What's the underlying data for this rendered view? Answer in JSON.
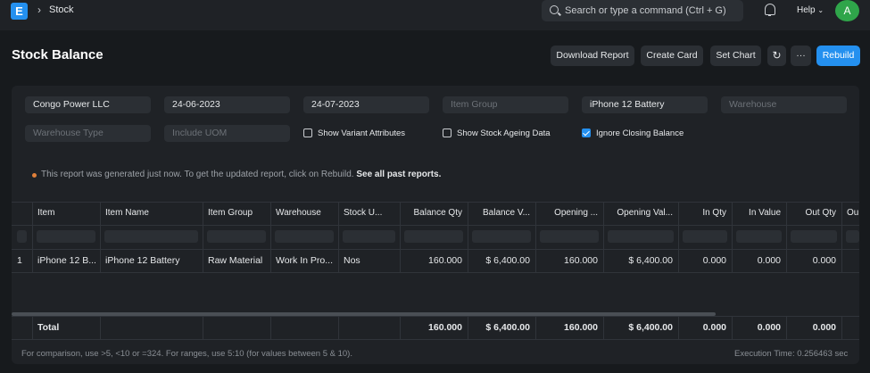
{
  "navbar": {
    "logo": "E",
    "breadcrumb": "Stock",
    "search_placeholder": "Search or type a command (Ctrl + G)",
    "help": "Help",
    "avatar": "A"
  },
  "page": {
    "title": "Stock Balance",
    "buttons": {
      "download": "Download Report",
      "create_card": "Create Card",
      "set_chart": "Set Chart",
      "more": "···",
      "rebuild": "Rebuild"
    }
  },
  "filters": {
    "company": "Congo Power LLC",
    "from_date": "24-06-2023",
    "to_date": "24-07-2023",
    "item_group_placeholder": "Item Group",
    "item": "iPhone 12 Battery",
    "warehouse_placeholder": "Warehouse",
    "warehouse_type_placeholder": "Warehouse Type",
    "include_uom_placeholder": "Include UOM",
    "show_variant": "Show Variant Attributes",
    "show_ageing": "Show Stock Ageing Data",
    "ignore_closing": "Ignore Closing Balance",
    "show_variant_checked": false,
    "show_ageing_checked": false,
    "ignore_closing_checked": true
  },
  "notice": {
    "text": "This report was generated just now. To get the updated report, click on Rebuild.",
    "link": "See all past reports."
  },
  "table": {
    "columns": [
      "Item",
      "Item Name",
      "Item Group",
      "Warehouse",
      "Stock U...",
      "Balance Qty",
      "Balance V...",
      "Opening ...",
      "Opening Val...",
      "In Qty",
      "In Value",
      "Out Qty",
      "Ou"
    ],
    "rows": [
      [
        "1",
        "iPhone 12 B...",
        "iPhone 12 Battery",
        "Raw Material",
        "Work In Pro...",
        "Nos",
        "160.000",
        "$ 6,400.00",
        "160.000",
        "$ 6,400.00",
        "0.000",
        "0.000",
        "0.000"
      ]
    ],
    "totals": [
      "Total",
      "160.000",
      "$ 6,400.00",
      "160.000",
      "$ 6,400.00",
      "0.000",
      "0.000",
      "0.000"
    ]
  },
  "footer": {
    "hint": "For comparison, use >5, <10 or =324. For ranges, use 5:10 (for values between 5 & 10).",
    "execution": "Execution Time: 0.256463 sec"
  },
  "colors": {
    "accent": "#2490ef",
    "avatar": "#2fa54a",
    "notice_dot": "#e0803a"
  }
}
